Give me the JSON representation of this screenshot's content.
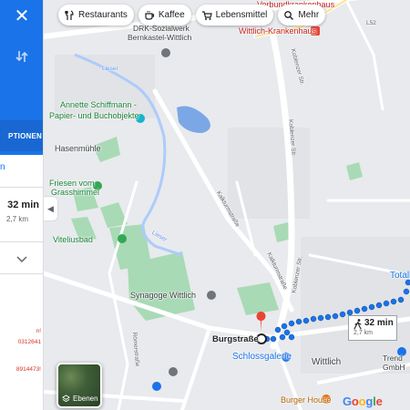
{
  "panel": {
    "close_icon": "close-icon",
    "swap_icon": "swap-icon",
    "options_label": "PTIONEN",
    "n_text": "n",
    "time": "32 min",
    "distance": "2,7 km",
    "red_lines": [
      "n!",
      "0312641",
      "8914473!"
    ]
  },
  "chips": [
    {
      "label": "Restaurants",
      "icon": "fork-knife-icon"
    },
    {
      "label": "Kaffee",
      "icon": "coffee-icon"
    },
    {
      "label": "Lebensmittel",
      "icon": "cart-icon"
    },
    {
      "label": "Mehr",
      "icon": "search-icon"
    }
  ],
  "map": {
    "labels": {
      "verbund": "Verbundkrankenhaus",
      "drk": "DRK-Sozialwerk",
      "drk2": "Bernkastel-Wittlich",
      "kranken": "Wittlich-Krankenhaus",
      "l52": "L52",
      "lieser1": "Lieser",
      "annette1": "Annette Schiffmann -",
      "annette2": "Papier- und Buchobjekte",
      "hasenmuehle": "Hasenmühle",
      "friesen1": "Friesen vom",
      "friesen2": "Grasshimmel",
      "viteliusbad": "Viteliusbad",
      "lieser2": "Lieser",
      "synagoge": "Synagoge Wittlich",
      "burgstrasse": "Burgstraße",
      "schlossgalerie": "Schlossgalerie",
      "wittlich": "Wittlich",
      "burger_house": "Burger House",
      "totall": "Totall",
      "trend1": "Trend",
      "trend2": "GmbH",
      "kobl1": "Koblenzer Str.",
      "kobl2": "Koblenzer Str.",
      "kobl3": "Koblenzer Str.",
      "kalk1": "Kalkturmstraße",
      "kalk2": "Kalkturmstraße",
      "romer": "Römerstraße"
    },
    "accent_color": "#1a73e8",
    "park_color": "#a8dab5"
  },
  "duration_box": {
    "time": "32 min",
    "distance": "2,7 km",
    "icon": "walking-icon"
  },
  "layers": {
    "label": "Ebenen",
    "icon": "layers-icon"
  },
  "logo": "Google"
}
